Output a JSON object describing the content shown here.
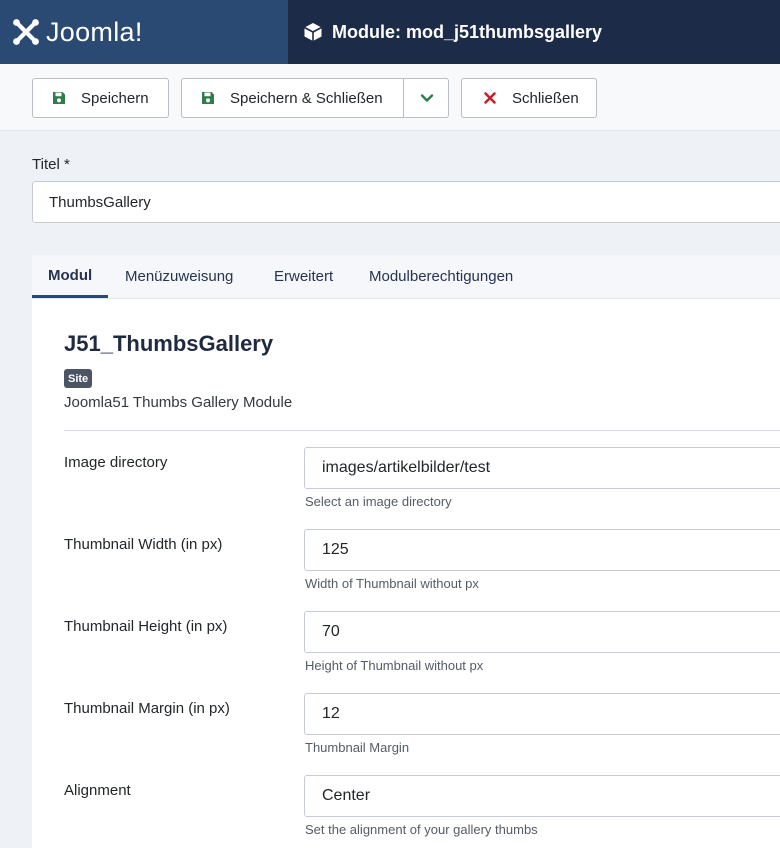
{
  "header": {
    "brand": "Joomla!",
    "page_title": "Module: mod_j51thumbsgallery"
  },
  "toolbar": {
    "save_label": "Speichern",
    "save_close_label": "Speichern & Schließen",
    "close_label": "Schließen"
  },
  "title_field": {
    "label": "Titel *",
    "value": "ThumbsGallery"
  },
  "tabs": [
    {
      "label": "Modul",
      "active": true
    },
    {
      "label": "Menüzuweisung",
      "active": false
    },
    {
      "label": "Erweitert",
      "active": false
    },
    {
      "label": "Modulberechtigungen",
      "active": false
    }
  ],
  "module": {
    "name": "J51_ThumbsGallery",
    "badge": "Site",
    "description": "Joomla51 Thumbs Gallery Module"
  },
  "fields": [
    {
      "label": "Image directory",
      "value": "images/artikelbilder/test",
      "help": "Select an image directory"
    },
    {
      "label": "Thumbnail Width (in px)",
      "value": "125",
      "help": "Width of Thumbnail without px"
    },
    {
      "label": "Thumbnail Height (in px)",
      "value": "70",
      "help": "Height of Thumbnail without px"
    },
    {
      "label": "Thumbnail Margin (in px)",
      "value": "12",
      "help": "Thumbnail Margin"
    },
    {
      "label": "Alignment",
      "value": "Center",
      "help": "Set the alignment of your gallery thumbs"
    }
  ],
  "colors": {
    "header_bg": "#1c2b47",
    "logo_bg": "#2a4a73",
    "save_icon": "#2f7d4a",
    "close_icon": "#c8202b",
    "chevron": "#2f7d4a"
  },
  "icons": {
    "logo": "joomla-logo-icon",
    "title": "cube-icon",
    "save": "floppy-disk-icon",
    "dropdown": "chevron-down-icon",
    "close": "close-icon"
  }
}
